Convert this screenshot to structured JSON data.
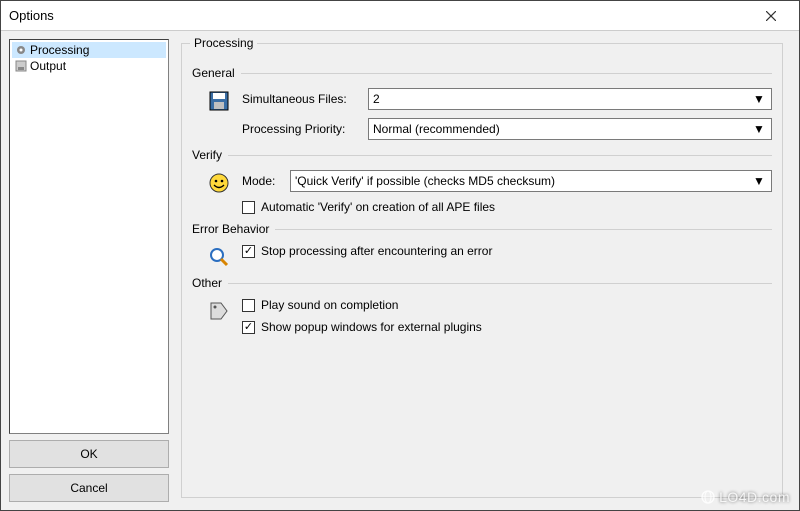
{
  "window": {
    "title": "Options"
  },
  "sidebar": {
    "items": [
      {
        "label": "Processing",
        "selected": true
      },
      {
        "label": "Output",
        "selected": false
      }
    ]
  },
  "buttons": {
    "ok": "OK",
    "cancel": "Cancel"
  },
  "panel": {
    "title": "Processing",
    "sections": {
      "general": {
        "heading": "General",
        "simultaneous_label": "Simultaneous Files:",
        "simultaneous_value": "2",
        "priority_label": "Processing Priority:",
        "priority_value": "Normal (recommended)"
      },
      "verify": {
        "heading": "Verify",
        "mode_label": "Mode:",
        "mode_value": "'Quick Verify' if possible (checks MD5 checksum)",
        "auto_verify_label": "Automatic 'Verify' on creation of all APE files",
        "auto_verify_checked": false
      },
      "error": {
        "heading": "Error Behavior",
        "stop_label": "Stop processing after encountering an error",
        "stop_checked": true
      },
      "other": {
        "heading": "Other",
        "play_sound_label": "Play sound on completion",
        "play_sound_checked": false,
        "popup_label": "Show popup windows for external plugins",
        "popup_checked": true
      }
    }
  },
  "watermark": "LO4D.com"
}
